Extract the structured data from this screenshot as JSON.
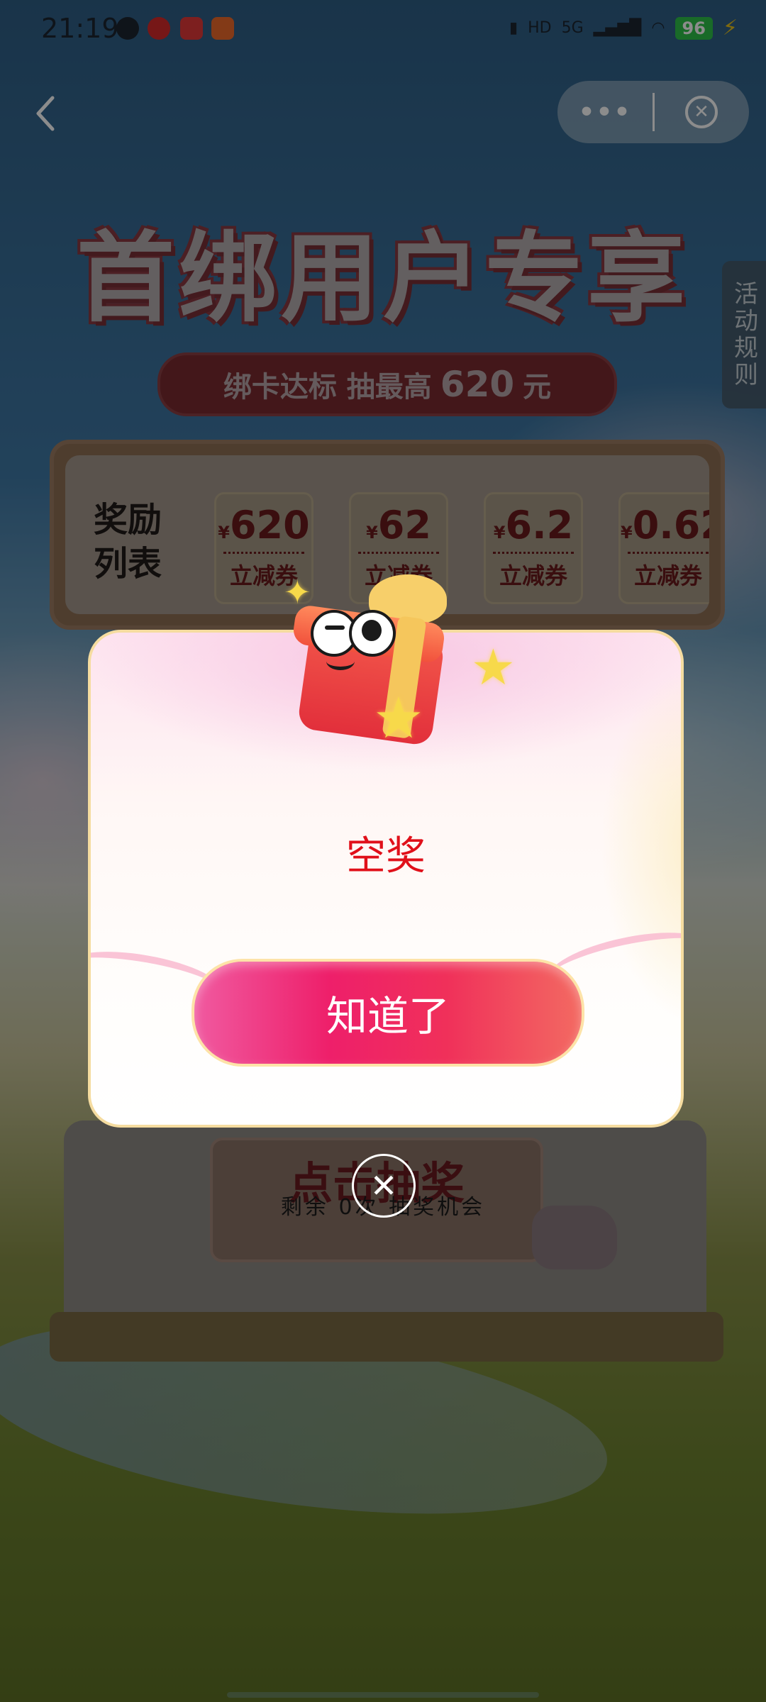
{
  "status_bar": {
    "time": "21:19",
    "network": "5G",
    "hd": "HD",
    "battery": "96"
  },
  "nav": {
    "back_icon": "chevron-left-icon",
    "more_label": "•••",
    "close_icon": "close-circle-icon"
  },
  "banner": {
    "title": "首绑用户专享",
    "subtitle_prefix": "绑卡达标 抽最高",
    "subtitle_amount": "620",
    "subtitle_unit": "元"
  },
  "rules_tab": "活动规则",
  "rewards": {
    "title_line1": "奖励",
    "title_line2": "列表",
    "currency": "¥",
    "items": [
      {
        "amount": "620",
        "label": "立减券"
      },
      {
        "amount": "62",
        "label": "立减券"
      },
      {
        "amount": "6.2",
        "label": "立减券"
      },
      {
        "amount": "0.62",
        "label": "立减券"
      }
    ]
  },
  "draw": {
    "button": "点击抽奖",
    "remaining": "剩余 0次 抽奖机会"
  },
  "modal": {
    "result": "空奖",
    "confirm": "知道了"
  },
  "colors": {
    "accent_red": "#e0101a",
    "button_pink": "#ee1f6a",
    "battery_green": "#2fc24a"
  }
}
